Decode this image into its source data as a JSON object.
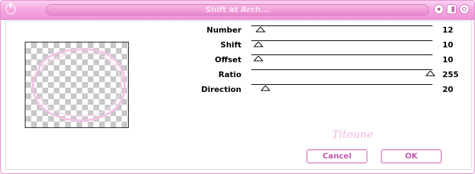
{
  "window": {
    "title": "Shift at Arch..."
  },
  "params": [
    {
      "label": "Number",
      "value": "12",
      "level": 0.05
    },
    {
      "label": "Shift",
      "value": "10",
      "level": 0.04
    },
    {
      "label": "Offset",
      "value": "10",
      "level": 0.04
    },
    {
      "label": "Ratio",
      "value": "255",
      "level": 1.0
    },
    {
      "label": "Direction",
      "value": "20",
      "level": 0.08
    }
  ],
  "signature": "Titoune",
  "buttons": {
    "cancel": "Cancel",
    "ok": "OK"
  },
  "colors": {
    "accent": "#ef96d8",
    "button_text": "#c35ab0",
    "preview_ring": "#f3c2e6"
  }
}
